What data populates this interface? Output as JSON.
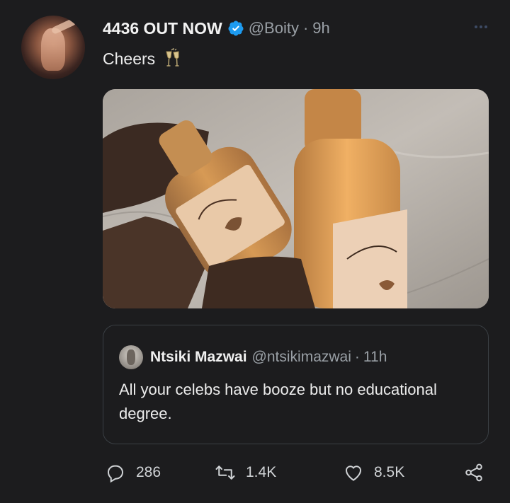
{
  "author": {
    "display_name": "4436 OUT NOW",
    "handle": "@Boity",
    "separator": "·",
    "time": "9h",
    "verified_icon": "verified-badge-icon"
  },
  "tweet": {
    "text": "Cheers",
    "emoji_icon": "clinking-glasses-icon"
  },
  "media": {
    "description_icon": "photo"
  },
  "quoted_tweet": {
    "display_name": "Ntsiki Mazwai",
    "handle": "@ntsikimazwai",
    "separator": "·",
    "time": "11h",
    "text": "All your celebs have booze but no educational degree."
  },
  "actions": {
    "replies": "286",
    "retweets": "1.4K",
    "likes": "8.5K"
  },
  "colors": {
    "background": "#1c1c1e",
    "verified": "#1d9bf0",
    "muted": "#9aa0a6"
  }
}
